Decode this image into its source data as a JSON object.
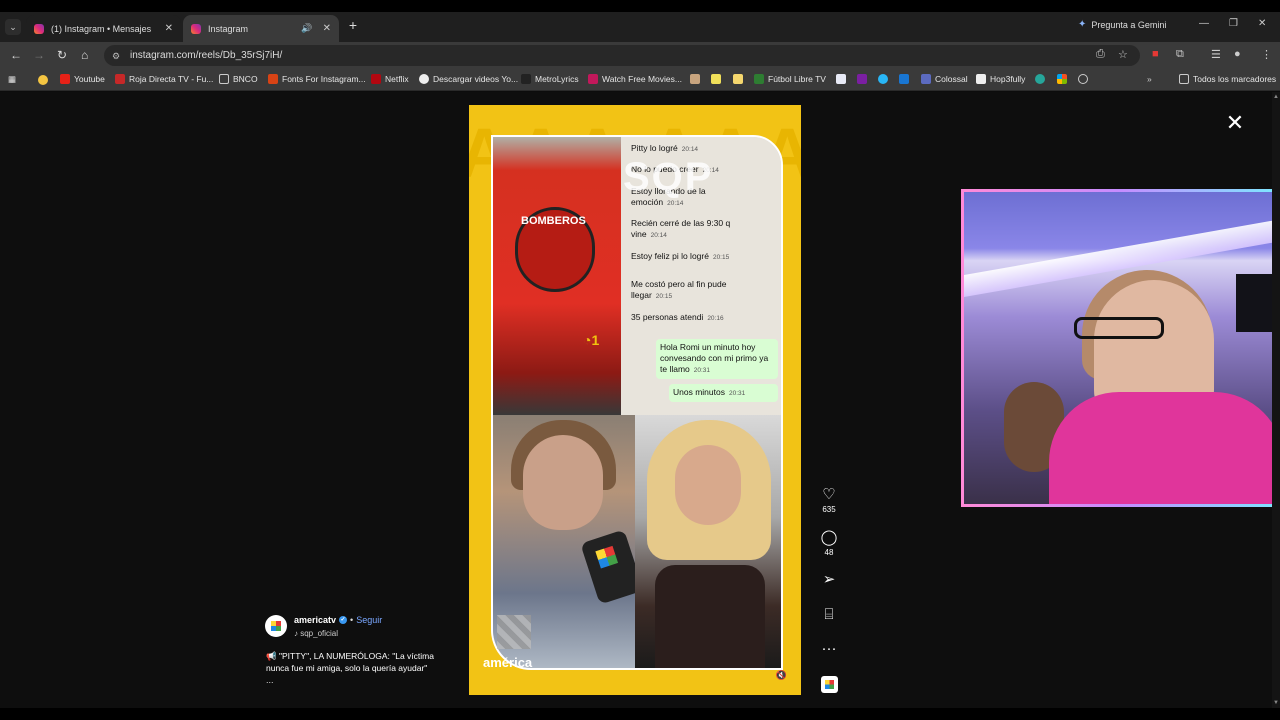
{
  "browser": {
    "tabs": [
      {
        "label": "(1) Instagram • Mensajes",
        "active": false
      },
      {
        "label": "Instagram",
        "active": true
      }
    ],
    "gemini_label": "Pregunta a Gemini",
    "url": "instagram.com/reels/Db_35rSj7iH/",
    "bookmarks": [
      "Youtube",
      "Roja Directa TV - Fu...",
      "BNCO",
      "Fonts For Instagram...",
      "Netflix",
      "Descargar videos Yo...",
      "MetroLyrics",
      "Watch Free Movies...",
      "Fútbol Libre TV",
      "Colossal",
      "Hop3fully"
    ],
    "all_bookmarks_label": "Todos los marcadores"
  },
  "reel": {
    "watermark": "SQP",
    "brand": "américa",
    "truck_label": "BOMBEROS",
    "chat": [
      {
        "text": "Pitty lo logré",
        "time": "20:14",
        "dir": "in"
      },
      {
        "text": "No lo puedo creer",
        "time": "20:14",
        "dir": "in"
      },
      {
        "text": "Estoy llorando de la emoción",
        "time": "20:14",
        "dir": "in"
      },
      {
        "text": "Recién cerré de las 9:30 q vine",
        "time": "20:14",
        "dir": "in"
      },
      {
        "text": "Estoy feliz pi lo logré",
        "time": "20:15",
        "dir": "in"
      },
      {
        "text": "Me costó pero al fin pude llegar",
        "time": "20:15",
        "dir": "in"
      },
      {
        "text": "35 personas atendi",
        "time": "20:16",
        "dir": "in"
      },
      {
        "text": "Hola Romi un minuto hoy convesando con mi primo ya te llamo",
        "time": "20:31",
        "dir": "out"
      },
      {
        "text": "Unos minutos",
        "time": "20:31",
        "dir": "out"
      }
    ]
  },
  "actions": {
    "likes": "635",
    "comments": "48"
  },
  "post": {
    "author": "americatv",
    "follow_label": "Seguir",
    "audio": "sqp_oficial",
    "caption": "\"PITTY\", LA NUMERÓLOGA: \"La víctima nunca fue mi amiga, solo la quería ayudar\"",
    "more": "..."
  }
}
